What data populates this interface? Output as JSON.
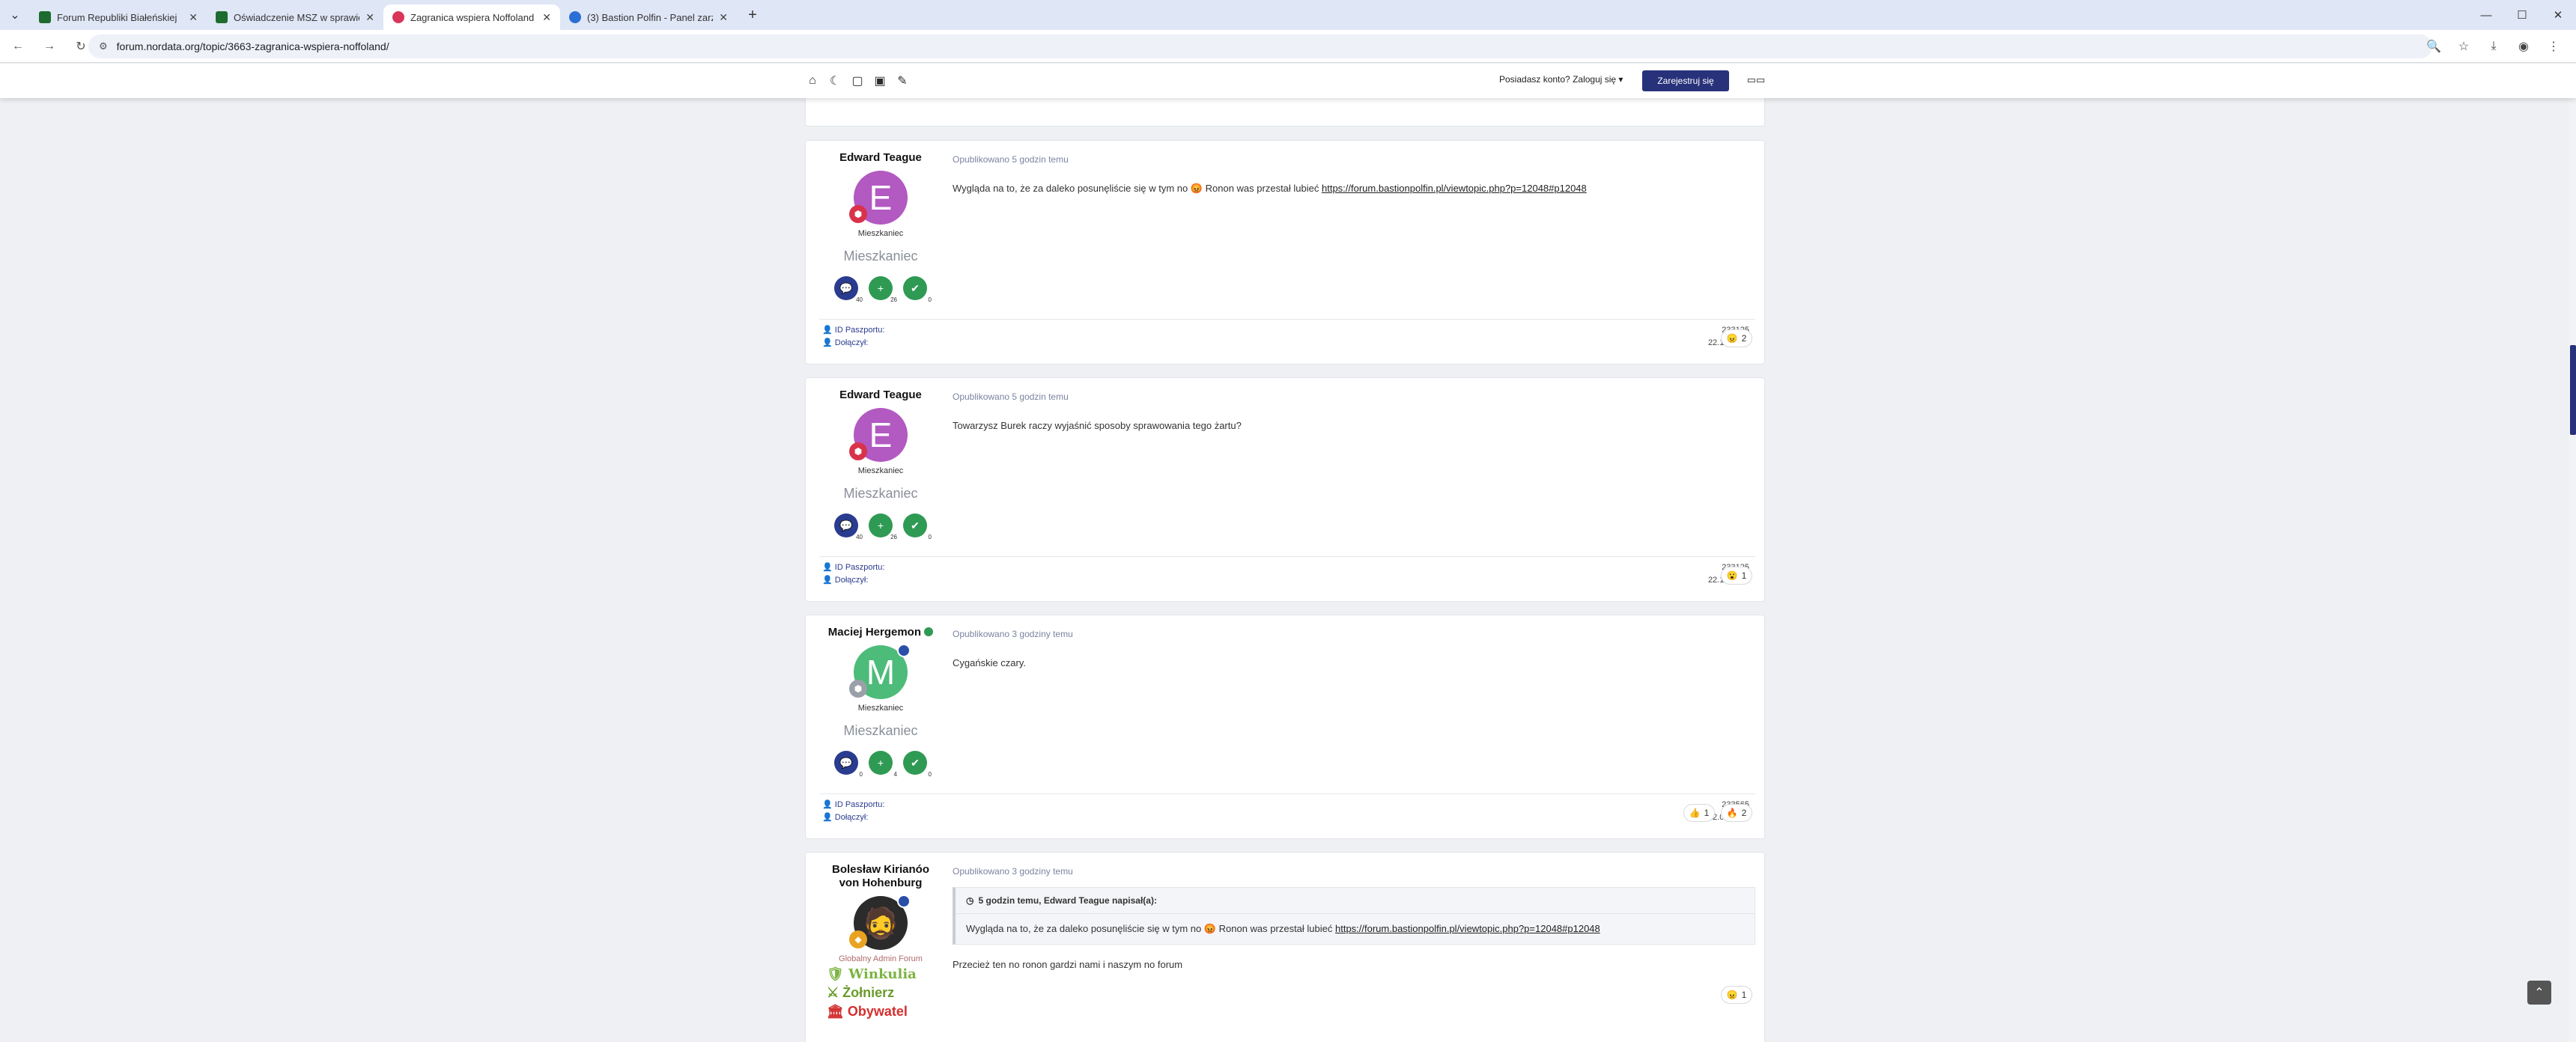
{
  "browser": {
    "tabs": [
      {
        "title": "Forum Republiki Białeńskiej",
        "active": false,
        "favicon_color": "#1d6b2e"
      },
      {
        "title": "Oświadczenie MSZ w sprawie N",
        "active": false,
        "favicon_color": "#1d6b2e"
      },
      {
        "title": "Zagranica wspiera Noffoland -",
        "active": true,
        "favicon_color": "#d9365a"
      },
      {
        "title": "(3) Bastion Polfin - Panel zarządz",
        "active": false,
        "favicon_color": "#2a6fd6"
      }
    ],
    "url": "forum.nordata.org/topic/3663-zagranica-wspiera-noffoland/"
  },
  "header": {
    "login_text": "Posiadasz konto? Zaloguj się ▾",
    "register_label": "Zarejestruj się"
  },
  "posts": [
    {
      "author": "Edward Teague",
      "avatar_letter": "E",
      "avatar_color": "#b259c2",
      "rank_badge_color": "#d8334a",
      "role": "Mieszkaniec",
      "group": "Mieszkaniec",
      "stats": [
        "40",
        "26",
        "0"
      ],
      "passport_label": "ID Paszportu:",
      "passport": "233125",
      "joined_label": "Dołączył:",
      "joined": "22.10.2025",
      "posted": "Opublikowano 5 godzin temu",
      "text_before": "Wygląda na to, że za daleko posunęliście się w tym no 😡 Ronon was przestał lubieć ",
      "link": "https://forum.bastionpolfin.pl/viewtopic.php?p=12048#p12048",
      "reactions": [
        {
          "emoji": "😠",
          "count": "2"
        }
      ]
    },
    {
      "author": "Edward Teague",
      "avatar_letter": "E",
      "avatar_color": "#b259c2",
      "rank_badge_color": "#d8334a",
      "role": "Mieszkaniec",
      "group": "Mieszkaniec",
      "stats": [
        "40",
        "26",
        "0"
      ],
      "passport_label": "ID Paszportu:",
      "passport": "233125",
      "joined_label": "Dołączył:",
      "joined": "22.10.2025",
      "posted": "Opublikowano 5 godzin temu",
      "text": "Towarzysz Burek raczy wyjaśnić sposoby sprawowania tego żartu?",
      "reactions": [
        {
          "emoji": "😮",
          "count": "1"
        }
      ]
    },
    {
      "author": "Maciej Hergemon",
      "avatar_letter": "M",
      "avatar_color": "#4dbb7a",
      "rank_badge_color": "#9aa0a8",
      "role": "Mieszkaniec",
      "group": "Mieszkaniec",
      "stats": [
        "0",
        "4",
        "0"
      ],
      "passport_label": "ID Paszportu:",
      "passport": "233565",
      "joined_label": "Dołączył:",
      "joined": "22.07.2026",
      "posted": "Opublikowano 3 godziny temu",
      "text": "Cygańskie czary.",
      "reactions": [
        {
          "emoji": "👍",
          "count": "1"
        },
        {
          "emoji": "🔥",
          "count": "2"
        }
      ]
    },
    {
      "author": "Bolesław Kirianóo von Hohenburg",
      "role": "Globalny Admin Forum",
      "posted": "Opublikowano 3 godziny temu",
      "quote_header": "5 godzin temu, Edward Teague napisał(a):",
      "quote_text": "Wygląda na to, że za daleko posunęliście się w tym no 😡 Ronon was przestał lubieć ",
      "quote_link": "https://forum.bastionpolfin.pl/viewtopic.php?p=12048#p12048",
      "text": "Przecież ten no ronon gardzi nami i naszym no forum",
      "signature": [
        "Winkulia",
        "Żołnierz",
        "Obywatel"
      ],
      "reactions": [
        {
          "emoji": "😠",
          "count": "1"
        }
      ]
    }
  ],
  "icons": {
    "home": "home-icon",
    "theme": "moon-icon",
    "layout": "layout-icon",
    "image": "image-icon",
    "brush": "brush-icon"
  },
  "colors": {
    "accent": "#27327a",
    "link": "#2a3c8f"
  }
}
